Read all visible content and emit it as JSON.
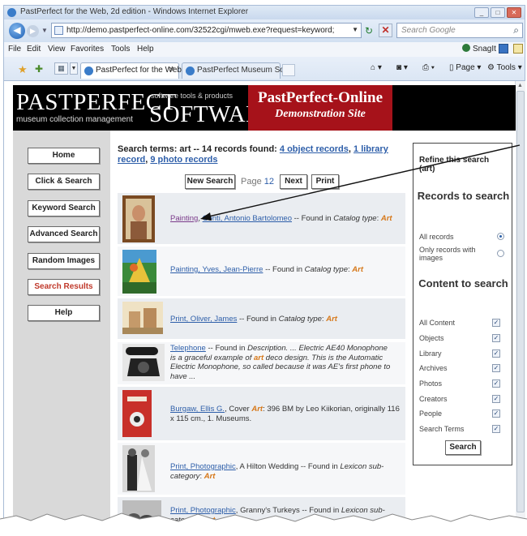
{
  "window": {
    "title": "PastPerfect for the Web, 2d edition - Windows Internet Explorer"
  },
  "address": {
    "url": "http://demo.pastperfect-online.com/32522cgi/mweb.exe?request=keyword;keyword=art;dty",
    "search_placeholder": "Search Google"
  },
  "menu": {
    "items": [
      "File",
      "Edit",
      "View",
      "Favorites",
      "Tools",
      "Help"
    ],
    "snagit": "SnagIt"
  },
  "tabs": [
    {
      "label": "PastPerfect for the Web...",
      "active": true
    },
    {
      "label": "PastPerfect Museum Soft...",
      "active": false
    }
  ],
  "commandbar": {
    "page": "Page",
    "tools": "Tools"
  },
  "banner": {
    "logo_past": "PASTPERFECT",
    "logo_software": "SOFTWARE",
    "logo_tagline_top": "software tools & products",
    "logo_tagline_bottom": "museum collection management",
    "demo_title": "PastPerfect-Online",
    "demo_subtitle": "Demonstration Site"
  },
  "sidebar": {
    "buttons": [
      "Home",
      "Click & Search",
      "Keyword Search",
      "Advanced Search",
      "Random Images",
      "Search Results",
      "Help"
    ],
    "current": "Search Results"
  },
  "results": {
    "summary_prefix": "Search terms: art -- 14 records found:",
    "link_objects": "4 object records",
    "link_library": "1 library record",
    "link_photos": "9 photo records",
    "new_search": "New Search",
    "page_label": "Page",
    "page_1": "1",
    "page_2": "2",
    "next": "Next",
    "print": "Print",
    "records": [
      {
        "link": "Painting",
        "link2": "Conti, Antonio Bartolomeo",
        "tail": "-- Found in",
        "tail_field": "Catalog type",
        "tail_value": "Art"
      },
      {
        "link": "Painting, Yves, Jean-Pierre",
        "tail": "-- Found in",
        "tail_field": "Catalog type",
        "tail_value": "Art"
      },
      {
        "link": "Print, Oliver, James",
        "tail": "-- Found in",
        "tail_field": "Catalog type",
        "tail_value": "Art"
      },
      {
        "link": "Telephone",
        "desc_a": "-- Found in",
        "desc_field": "Description.",
        "desc_b": "... Electric AE40 Monophone is a graceful example of",
        "desc_hit": "art",
        "desc_c": "deco design. This is the Automatic Electric Monophone, so called because it was AE's first phone to have ..."
      },
      {
        "link": "Burgaw, Ellis G.",
        "desc_a": ", Cover",
        "desc_hit": "Art",
        "desc_c": ": 396 BM by Leo Kiikorian, originally 116 x 115 cm., 1. Museums."
      },
      {
        "link": "Print, Photographic",
        "desc_a": ", A Hilton Wedding -- Found in",
        "desc_field": "Lexicon sub-category",
        "desc_hit": "Art"
      },
      {
        "link": "Print, Photographic",
        "desc_a": ", Granny's Turkeys -- Found in",
        "desc_field": "Lexicon sub-category",
        "desc_hit": "Art"
      }
    ]
  },
  "refine": {
    "title_line1": "Refine this search",
    "title_line2": "(art)",
    "records_header": "Records to search",
    "all_records": "All records",
    "only_images": "Only records with images",
    "records_selected": "All records",
    "content_header": "Content to search",
    "content_items": [
      {
        "label": "All Content",
        "checked": true
      },
      {
        "label": "Objects",
        "checked": true
      },
      {
        "label": "Library",
        "checked": true
      },
      {
        "label": "Archives",
        "checked": true
      },
      {
        "label": "Photos",
        "checked": true
      },
      {
        "label": "Creators",
        "checked": true
      },
      {
        "label": "People",
        "checked": true
      },
      {
        "label": "Search Terms",
        "checked": true
      }
    ],
    "search_button": "Search"
  },
  "colors": {
    "banner_red": "#a6121a",
    "link_blue": "#2d5ea9",
    "current_red": "#c0392b",
    "art_orange": "#d67718",
    "sidebar_gray": "#d9d9d9"
  }
}
